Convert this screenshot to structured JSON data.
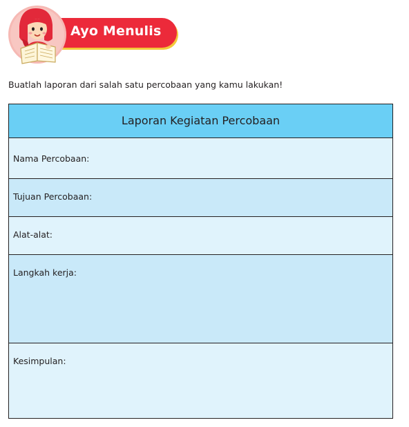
{
  "header": {
    "title": "Ayo Menulis",
    "mascot_icon": "girl-reading-book-icon",
    "pill_color": "#ec2a3a",
    "shadow_color": "#f3c93a"
  },
  "instruction": "Buatlah laporan dari salah satu percobaan yang kamu lakukan!",
  "report_form": {
    "title": "Laporan Kegiatan Percobaan",
    "title_bg": "#6acff5",
    "fields": [
      {
        "label": "Nama Percobaan:"
      },
      {
        "label": "Tujuan Percobaan:"
      },
      {
        "label": "Alat-alat:"
      },
      {
        "label": "Langkah kerja:"
      },
      {
        "label": "Kesimpulan:"
      }
    ]
  }
}
